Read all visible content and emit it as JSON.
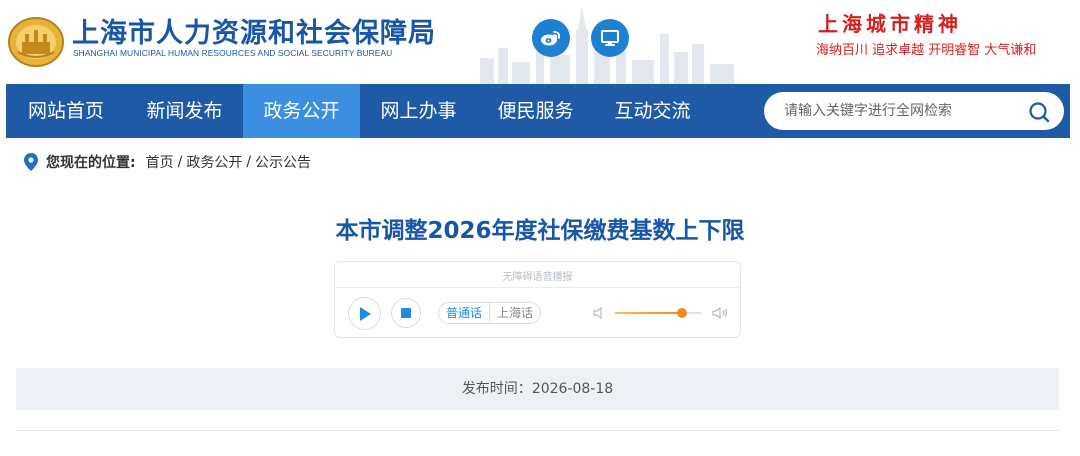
{
  "header": {
    "site_title": "上海市人力资源和社会保障局",
    "site_subtitle": "SHANGHAI MUNICIPAL HUMAN RESOURCES AND SOCIAL SECURITY BUREAU",
    "city_spirit_title": "上海城市精神",
    "city_spirit_text": "海纳百川 追求卓越 开明睿智 大气谦和",
    "icons": [
      "emblem-icon",
      "weibo-icon",
      "computer-icon"
    ]
  },
  "nav": {
    "items": [
      {
        "label": "网站首页"
      },
      {
        "label": "新闻发布"
      },
      {
        "label": "政务公开"
      },
      {
        "label": "网上办事"
      },
      {
        "label": "便民服务"
      },
      {
        "label": "互动交流"
      }
    ],
    "active_index": 2,
    "search": {
      "placeholder": "请输入关键字进行全网检索"
    }
  },
  "breadcrumb": {
    "label": "您现在的位置:",
    "items": [
      "首页",
      "政务公开",
      "公示公告"
    ],
    "separator": "/"
  },
  "article": {
    "title": "本市调整2026年度社保缴费基数上下限",
    "publish_label": "发布时间：",
    "publish_date": "2026-08-18"
  },
  "player": {
    "caption": "无障碍语音播报",
    "languages": [
      "普通话",
      "上海话"
    ],
    "selected_language": "普通话",
    "volume_fraction": 0.78
  },
  "colors": {
    "brand_blue": "#1f5aa6",
    "active_tab": "#3b8ee0",
    "title_blue": "#1a56a6",
    "spirit_red": "#d42120",
    "volume_orange": "#f08a1e"
  }
}
